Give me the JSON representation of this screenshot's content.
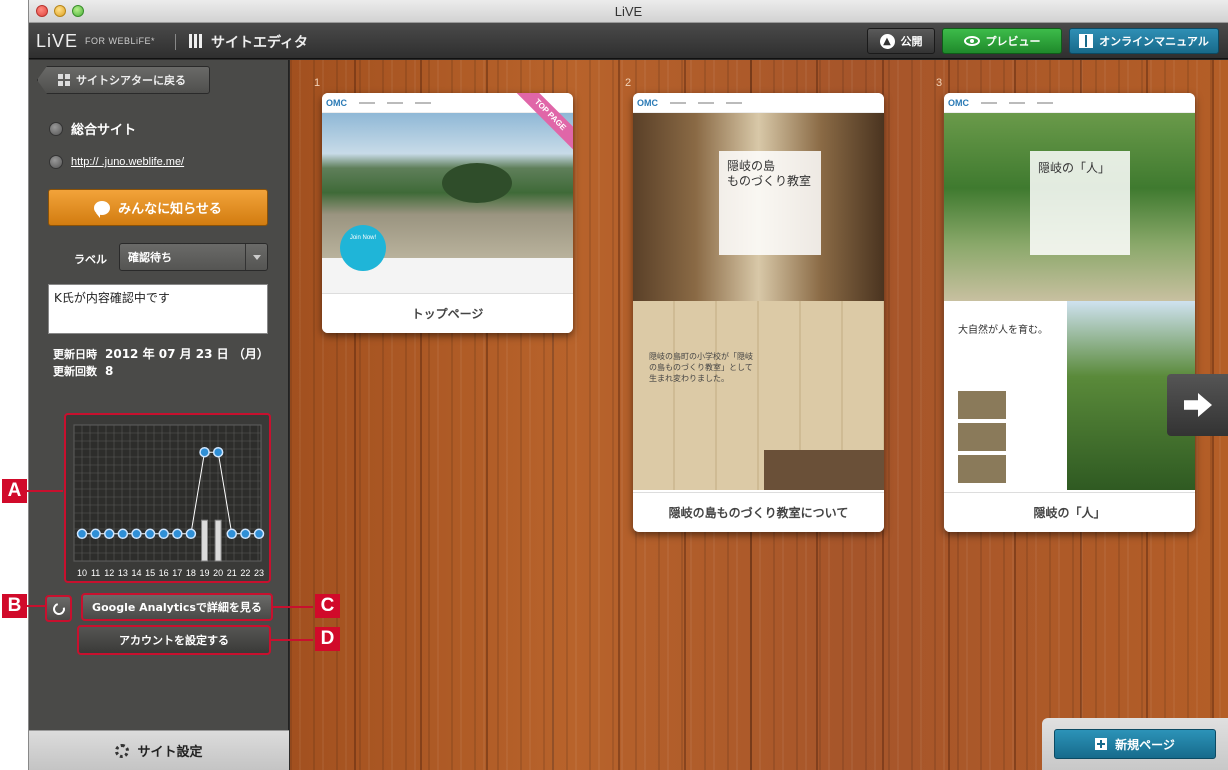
{
  "window": {
    "title": "LiVE"
  },
  "toolbar": {
    "logo": "LiVE",
    "logo_sub": "FOR WEBLiFE*",
    "editor_title": "サイトエディタ",
    "publish_label": "公開",
    "preview_label": "プレビュー",
    "manual_label": "オンラインマニュアル"
  },
  "sidebar": {
    "back_label": "サイトシアターに戻る",
    "site_name": "総合サイト",
    "site_url": "http://        .juno.weblife.me/",
    "notify_label": "みんなに知らせる",
    "label_caption": "ラベル",
    "label_value": "確認待ち",
    "memo": "K氏が内容確認中です",
    "updated_date_label": "更新日時",
    "updated_date": "2012 年 07 月 23 日 （月）",
    "update_count_label": "更新回数",
    "update_count": "8",
    "ga_button": "Google Analyticsで詳細を見る",
    "account_button": "アカウントを設定する",
    "settings_label": "サイト設定"
  },
  "markers": {
    "a": "A",
    "b": "B",
    "c": "C",
    "d": "D"
  },
  "pages": [
    {
      "number": "1",
      "caption": "トップページ",
      "ribbon": "TOP PAGE",
      "badge": "Join Now!"
    },
    {
      "number": "2",
      "caption": "隠岐の島ものづくり教室について",
      "overlay_title": "隠岐の島\nものづくり教室",
      "overlay_sub": "隠岐の島町の小学校が「隠岐の島ものづくり教室」として生まれ変わりました。"
    },
    {
      "number": "3",
      "caption": "隠岐の「人」",
      "overlay_title": "隠岐の「人」",
      "overlay_sub": "大自然が人を育む。"
    }
  ],
  "new_page_label": "新規ページ",
  "colors": {
    "accent_orange": "#e08a1e",
    "preview_green": "#2aa838",
    "manual_blue": "#1f7ea3",
    "marker_red": "#d10a2a"
  },
  "chart_data": {
    "type": "line",
    "categories": [
      "10",
      "11",
      "12",
      "13",
      "14",
      "15",
      "16",
      "17",
      "18",
      "19",
      "20",
      "21",
      "22",
      "23"
    ],
    "series": [
      {
        "values": [
          1,
          1,
          1,
          1,
          1,
          1,
          1,
          1,
          1,
          4,
          4,
          1,
          1,
          1
        ]
      }
    ],
    "bars": [
      0,
      0,
      0,
      0,
      0,
      0,
      0,
      0,
      0,
      1.5,
      1.5,
      0,
      0,
      0
    ],
    "ylim": [
      0,
      5
    ],
    "grid": true
  }
}
